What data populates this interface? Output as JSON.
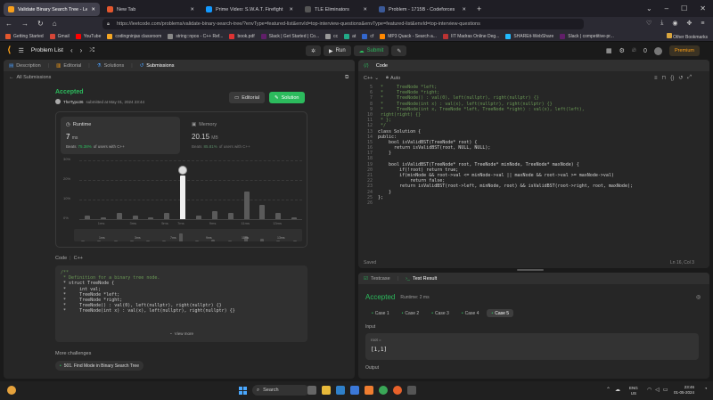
{
  "browser": {
    "tabs": [
      {
        "label": "Validate Binary Search Tree - Le",
        "color": "#f89f1b",
        "active": true
      },
      {
        "label": "New Tab",
        "color": "#e4572e",
        "active": false
      },
      {
        "label": "Prime Video: S.W.A.T. Firefight",
        "color": "#1399ff",
        "active": false
      },
      {
        "label": "TLE Eliminators",
        "color": "#555",
        "active": false
      },
      {
        "label": "Problem - 1715B - Codeforces",
        "color": "#3b5998",
        "active": false
      }
    ],
    "url": "https://leetcode.com/problems/validate-binary-search-tree/?envType=featured-list&envId=top-interview-questions&envType=featured-list&envId=top-interview-questions",
    "bookmarks": [
      "Getting Started",
      "Gmail",
      "YouTube",
      "codingninjas classroom",
      "string::npos - C++ Ref...",
      "book.pdf",
      "Slack | Get Started | Co...",
      "cc",
      "at",
      "cf",
      "MP3 Quack - Search a...",
      "IIT Madras Online Deg...",
      "SHAREit-WebShare",
      "Slack | competitive-pr..."
    ],
    "other_bookmarks": "Other Bookmarks"
  },
  "nav": {
    "problem_list": "Problem List",
    "run": "Run",
    "submit": "Submit",
    "premium": "Premium",
    "fire_count": "0"
  },
  "left": {
    "tabs": [
      "Description",
      "Editorial",
      "Solutions",
      "Submissions"
    ],
    "all_submissions": "All Submissions",
    "status": "Accepted",
    "user": "TheTypo36",
    "submitted": "submitted at May 01, 2024 23:44",
    "editorial_btn": "Editorial",
    "solution_btn": "Solution",
    "runtime": {
      "label": "Runtime",
      "value": "7",
      "unit": "ms",
      "beats_label": "Beats",
      "beats": "75.38%",
      "suffix": "of users with C++"
    },
    "memory": {
      "label": "Memory",
      "value": "20.15",
      "unit": "MB",
      "beats_label": "Beats",
      "beats": "85.81%",
      "suffix": "of users with C++"
    },
    "code_label": "Code",
    "code_lang": "C++",
    "code": [
      "/**",
      " * Definition for a binary tree node.",
      " * struct TreeNode {",
      " *     int val;",
      " *     TreeNode *left;",
      " *     TreeNode *right;",
      " *     TreeNode() : val(0), left(nullptr), right(nullptr) {}",
      " *     TreeNode(int x) : val(x), left(nullptr), right(nullptr) {}"
    ],
    "view_more": "View more",
    "more_challenges": "More challenges",
    "challenge": "501. Find Mode in Binary Search Tree"
  },
  "chart_data": {
    "type": "bar",
    "title": "",
    "ylabel": "",
    "yticks": [
      "30%",
      "20%",
      "10%",
      "0%"
    ],
    "ylim": [
      0,
      30
    ],
    "categories": [
      "",
      "1ms",
      "",
      "3ms",
      "",
      "5ms",
      "7ms",
      "",
      "9ms",
      "",
      "11ms",
      "",
      "13ms",
      ""
    ],
    "values": [
      2,
      1,
      3,
      2,
      1,
      3,
      22,
      2,
      4,
      3,
      14,
      7,
      3,
      1
    ],
    "highlight_index": 6,
    "mini_labels": [
      "1ms",
      "3ms",
      "7ms",
      "9ms",
      "11ms",
      "13ms"
    ]
  },
  "editor": {
    "title": "Code",
    "lang": "C++",
    "auto": "Auto",
    "first_line": 5,
    "lines": [
      " *     TreeNode *left;",
      " *     TreeNode *right;",
      " *     TreeNode() : val(0), left(nullptr), right(nullptr) {}",
      " *     TreeNode(int x) : val(x), left(nullptr), right(nullptr) {}",
      " *     TreeNode(int x, TreeNode *left, TreeNode *right) : val(x), left(left),",
      " right(right) {}",
      " * };",
      " */",
      "class Solution {",
      "public:",
      "    bool isValidBST(TreeNode* root) {",
      "      return isValidBST(root, NULL, NULL);",
      "    }",
      "",
      "    bool isValidBST(TreeNode* root, TreeNode* minNode, TreeNode* maxNode) {",
      "        if(!root) return true;",
      "        if(minNode && root->val <= minNode->val || maxNode && root->val >= maxNode->val)",
      "            return false;",
      "        return isValidBST(root->left, minNode, root) && isValidBST(root->right, root, maxNode);",
      "    }",
      "};",
      ""
    ],
    "saved": "Saved",
    "cursor": "Ln 16, Col 3"
  },
  "results": {
    "tabs": [
      "Testcase",
      "Test Result"
    ],
    "status": "Accepted",
    "runtime": "Runtime: 2 ms",
    "cases": [
      "Case 1",
      "Case 2",
      "Case 3",
      "Case 4",
      "Case 5"
    ],
    "selected_case": 4,
    "input_label": "Input",
    "var_name": "root =",
    "input_value": "[1,1]",
    "output_label": "Output"
  },
  "taskbar": {
    "search": "Search",
    "lang": "ENG",
    "region": "US",
    "time": "23:46",
    "date": "01-05-2024"
  }
}
